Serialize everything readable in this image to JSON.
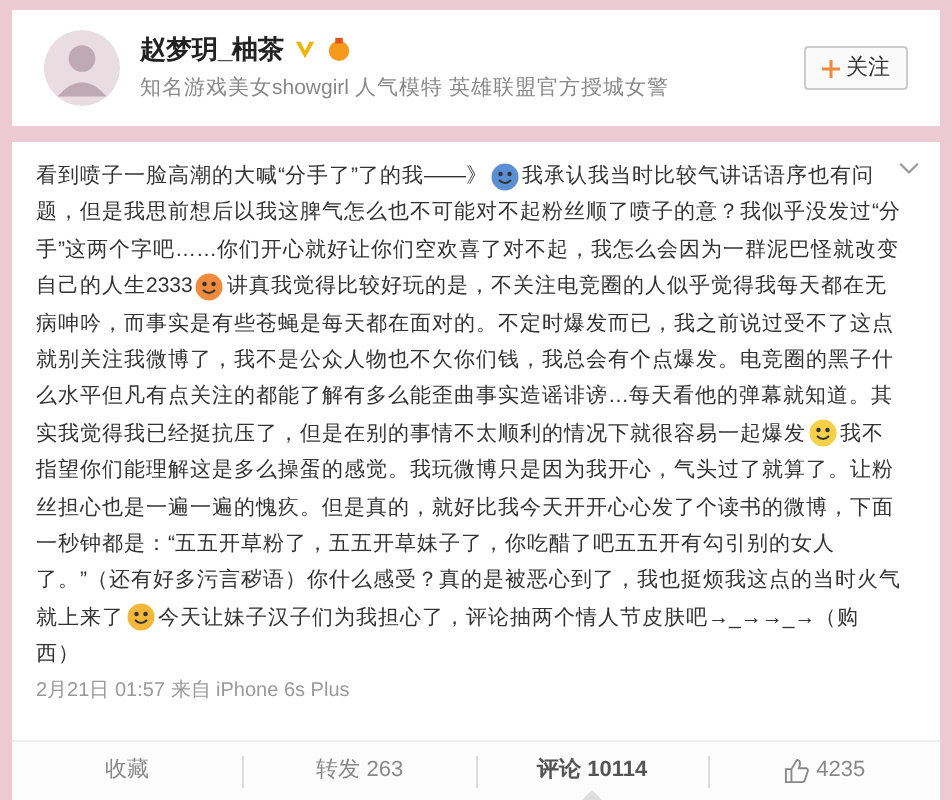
{
  "profile": {
    "name": "赵梦玥_柚茶",
    "verified": true,
    "bio": "知名游戏美女showgirl 人气模特 英雄联盟官方授城女警",
    "follow_button": {
      "label": "关注"
    }
  },
  "post": {
    "lines": [
      [
        {
          "kind": "text",
          "text": "看到喷子一脸高潮的大喊“分手了”了的我——》"
        },
        {
          "kind": "emoji",
          "color": "#5a8fd6"
        },
        {
          "kind": "text",
          "text": "我承认我当时比较气讲话语序也有问"
        }
      ],
      [
        {
          "kind": "text",
          "text": "题，但是我思前想后以我这脾气怎么也不可能对不起粉丝顺了喷子的意？我似乎没发过“分"
        }
      ],
      [
        {
          "kind": "text",
          "text": "手”这两个字吧……你们开心就好让你们空欢喜了对不起，我怎么会因为一群泥巴怪就改变"
        }
      ],
      [
        {
          "kind": "text",
          "text": "自己的人生2333"
        },
        {
          "kind": "emoji",
          "color": "#f08a3c"
        },
        {
          "kind": "text",
          "text": "讲真我觉得比较好玩的是，不关注电竞圈的人似乎觉得我每天都在无"
        }
      ],
      [
        {
          "kind": "text",
          "text": "病呻吟，而事实是有些苍蝇是每天都在面对的。不定时爆发而已，我之前说过受不了这点"
        }
      ],
      [
        {
          "kind": "text",
          "text": "就别关注我微博了，我不是公众人物也不欠你们钱，我总会有个点爆发。电竞圈的黑子什"
        }
      ],
      [
        {
          "kind": "text",
          "text": "么水平但凡有点关注的都能了解有多么能歪曲事实造谣诽谤…每天看他的弹幕就知道。其"
        }
      ],
      [
        {
          "kind": "text",
          "text": "实我觉得我已经挺抗压了，但是在别的事情不太顺利的情况下就很容易一起爆发"
        },
        {
          "kind": "emoji",
          "color": "#f5d04a"
        },
        {
          "kind": "text",
          "text": "我不"
        }
      ],
      [
        {
          "kind": "text",
          "text": "指望你们能理解这是多么操蛋的感觉。我玩微博只是因为我开心，气头过了就算了。让粉"
        }
      ],
      [
        {
          "kind": "text",
          "text": "丝担心也是一遍一遍的愧疚。但是真的，就好比我今天开开心心发了个读书的微博，下面"
        }
      ],
      [
        {
          "kind": "text",
          "text": "一秒钟都是：“五五开草粉了，五五开草妹子了，你吃醋了吧五五开有勾引别的女人"
        }
      ],
      [
        {
          "kind": "text",
          "text": "了。”（还有好多污言秽语）你什么感受？真的是被恶心到了，我也挺烦我这点的当时火气"
        }
      ],
      [
        {
          "kind": "text",
          "text": "就上来了"
        },
        {
          "kind": "emoji",
          "color": "#f3b73a"
        },
        {
          "kind": "text",
          "text": "今天让妹子汉子们为我担心了，评论抽两个情人节皮肤吧→_→→_→（购"
        }
      ],
      [
        {
          "kind": "text",
          "text": "西）"
        }
      ]
    ],
    "meta": "2月21日 01:57 来自 iPhone 6s Plus",
    "actions": [
      {
        "kind": "text",
        "label": "收藏",
        "selected": false
      },
      {
        "kind": "text",
        "label": "转发 263",
        "selected": false
      },
      {
        "kind": "text",
        "label": "评论 10114",
        "selected": true
      },
      {
        "kind": "like",
        "label": "4235",
        "selected": false
      }
    ]
  }
}
